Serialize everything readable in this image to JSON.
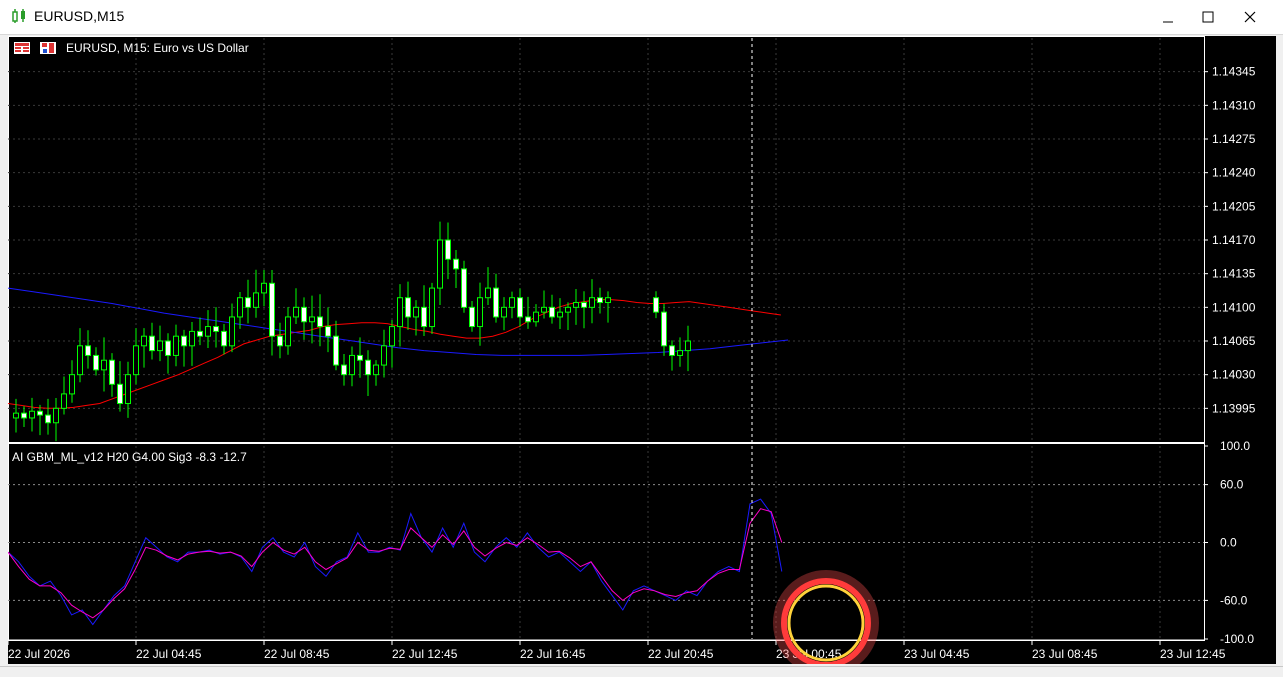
{
  "window": {
    "title": "EURUSD,M15"
  },
  "chart_header": {
    "symbol_line": "EURUSD, M15:  Euro vs US Dollar"
  },
  "indicator": {
    "label": "AI GBM_ML_v12 H20 G4.00 Sig3 -8.3 -12.7"
  },
  "colors": {
    "bull": "#00ff00",
    "ma_fast": "#ff0000",
    "ma_slow": "#1a1aff",
    "osc_main": "#1a1aff",
    "osc_signal": "#ff00c8",
    "grid": "#3a3a3a",
    "highlight": "#ff3b3b"
  },
  "icons": [
    "chart-app-icon",
    "minimize-icon",
    "maximize-icon",
    "close-icon",
    "toolbar-chart-icon",
    "toolbar-floppy-icon"
  ],
  "chart_data": [
    {
      "type": "candlestick",
      "title": "EURUSD, M15:  Euro vs US Dollar",
      "ylim": [
        1.1396,
        1.1438
      ],
      "price_ticks": [
        "1.14345",
        "1.14310",
        "1.14275",
        "1.14240",
        "1.14205",
        "1.14170",
        "1.14135",
        "1.14100",
        "1.14065",
        "1.14030",
        "1.13995"
      ],
      "time_ticks": [
        "22 Jul 2026",
        "22 Jul 04:45",
        "22 Jul 08:45",
        "22 Jul 12:45",
        "22 Jul 16:45",
        "22 Jul 20:45",
        "23 Jul 00:45",
        "23 Jul 04:45",
        "23 Jul 08:45",
        "23 Jul 12:45"
      ],
      "close_path": [
        1.1399,
        1.13985,
        1.13992,
        1.13988,
        1.1398,
        1.13995,
        1.1401,
        1.1403,
        1.1406,
        1.1405,
        1.14035,
        1.14045,
        1.1402,
        1.14,
        1.1403,
        1.1406,
        1.1407,
        1.14055,
        1.14065,
        1.1405,
        1.1407,
        1.1406,
        1.14075,
        1.1407,
        1.1408,
        1.14075,
        1.1406,
        1.1409,
        1.1411,
        1.141,
        1.14115,
        1.14125,
        1.1407,
        1.1406,
        1.1409,
        1.141,
        1.14085,
        1.1409,
        1.1408,
        1.1407,
        1.1404,
        1.1403,
        1.1405,
        1.14045,
        1.1403,
        1.1404,
        1.1406,
        1.1408,
        1.1411,
        1.1409,
        1.141,
        1.1408,
        1.1412,
        1.1417,
        1.1415,
        1.1414,
        1.141,
        1.1408,
        1.1411,
        1.1412,
        1.1409,
        1.141,
        1.1411,
        1.1409,
        1.14085,
        1.14095,
        1.141,
        1.1409,
        1.14095,
        1.141,
        1.14105,
        1.141,
        1.1411,
        1.14105,
        1.1411,
        1.14095,
        1.1406,
        1.1405,
        1.14055,
        1.14065
      ],
      "ma_fast": [
        1.14,
        1.13998,
        1.13996,
        1.13995,
        1.13995,
        1.13996,
        1.13998,
        1.14,
        1.14005,
        1.1401,
        1.14015,
        1.1402,
        1.14025,
        1.1403,
        1.14036,
        1.14042,
        1.14048,
        1.14055,
        1.14062,
        1.14066,
        1.1407,
        1.14072,
        1.14074,
        1.14076,
        1.1408,
        1.14082,
        1.14083,
        1.14084,
        1.14084,
        1.14083,
        1.1408,
        1.14077,
        1.14075,
        1.14072,
        1.1407,
        1.14068,
        1.14068,
        1.1407,
        1.14074,
        1.1408,
        1.14088,
        1.14094,
        1.141,
        1.14104,
        1.14106,
        1.14108,
        1.14108,
        1.14107,
        1.14105,
        1.14104,
        1.14104,
        1.14105,
        1.14106,
        1.14104,
        1.14102,
        1.141,
        1.14098,
        1.14096,
        1.14094,
        1.14092
      ],
      "ma_slow": [
        1.1412,
        1.14116,
        1.14112,
        1.14108,
        1.14104,
        1.14099,
        1.14094,
        1.1409,
        1.14086,
        1.14082,
        1.14078,
        1.14074,
        1.1407,
        1.14066,
        1.14062,
        1.14058,
        1.14055,
        1.14053,
        1.14051,
        1.1405,
        1.1405,
        1.1405,
        1.1405,
        1.14051,
        1.14052,
        1.14053,
        1.14055,
        1.14057,
        1.1406,
        1.14063,
        1.14066
      ],
      "crosshair_time": "23 Jul 00:45"
    },
    {
      "type": "line",
      "title": "AI GBM_ML_v12 H20 G4.00 Sig3 -8.3 -12.7",
      "ylim": [
        -100,
        100
      ],
      "ticks": [
        "100.0",
        "60.0",
        "0.0",
        "-60.0",
        "-100.0"
      ],
      "series": [
        {
          "values": [
            -10,
            -20,
            -35,
            -45,
            -40,
            -55,
            -75,
            -70,
            -85,
            -70,
            -55,
            -45,
            -20,
            5,
            -5,
            -15,
            -20,
            -10,
            -10,
            -8,
            -12,
            -10,
            -15,
            -30,
            -5,
            5,
            -10,
            -15,
            0,
            -25,
            -35,
            -20,
            -15,
            10,
            -10,
            -10,
            -5,
            -8,
            30,
            5,
            -10,
            15,
            -5,
            20,
            -10,
            -20,
            -5,
            5,
            -5,
            10,
            -5,
            -15,
            -10,
            -20,
            -30,
            -20,
            -40,
            -55,
            -70,
            -50,
            -45,
            -50,
            -55,
            -60,
            -50,
            -55,
            -40,
            -30,
            -25,
            -30,
            40,
            45,
            30,
            -30
          ]
        },
        {
          "values": [
            -10,
            -25,
            -38,
            -45,
            -45,
            -52,
            -65,
            -72,
            -78,
            -70,
            -58,
            -48,
            -28,
            -5,
            -8,
            -14,
            -18,
            -12,
            -10,
            -9,
            -11,
            -10,
            -14,
            -25,
            -10,
            0,
            -8,
            -12,
            -5,
            -20,
            -28,
            -22,
            -16,
            0,
            -8,
            -9,
            -6,
            -7,
            15,
            5,
            -5,
            8,
            -2,
            12,
            -5,
            -14,
            -6,
            0,
            -3,
            5,
            -2,
            -10,
            -9,
            -16,
            -25,
            -20,
            -35,
            -50,
            -60,
            -52,
            -48,
            -50,
            -54,
            -56,
            -52,
            -50,
            -40,
            -32,
            -28,
            -28,
            20,
            35,
            32,
            0
          ]
        }
      ]
    }
  ]
}
